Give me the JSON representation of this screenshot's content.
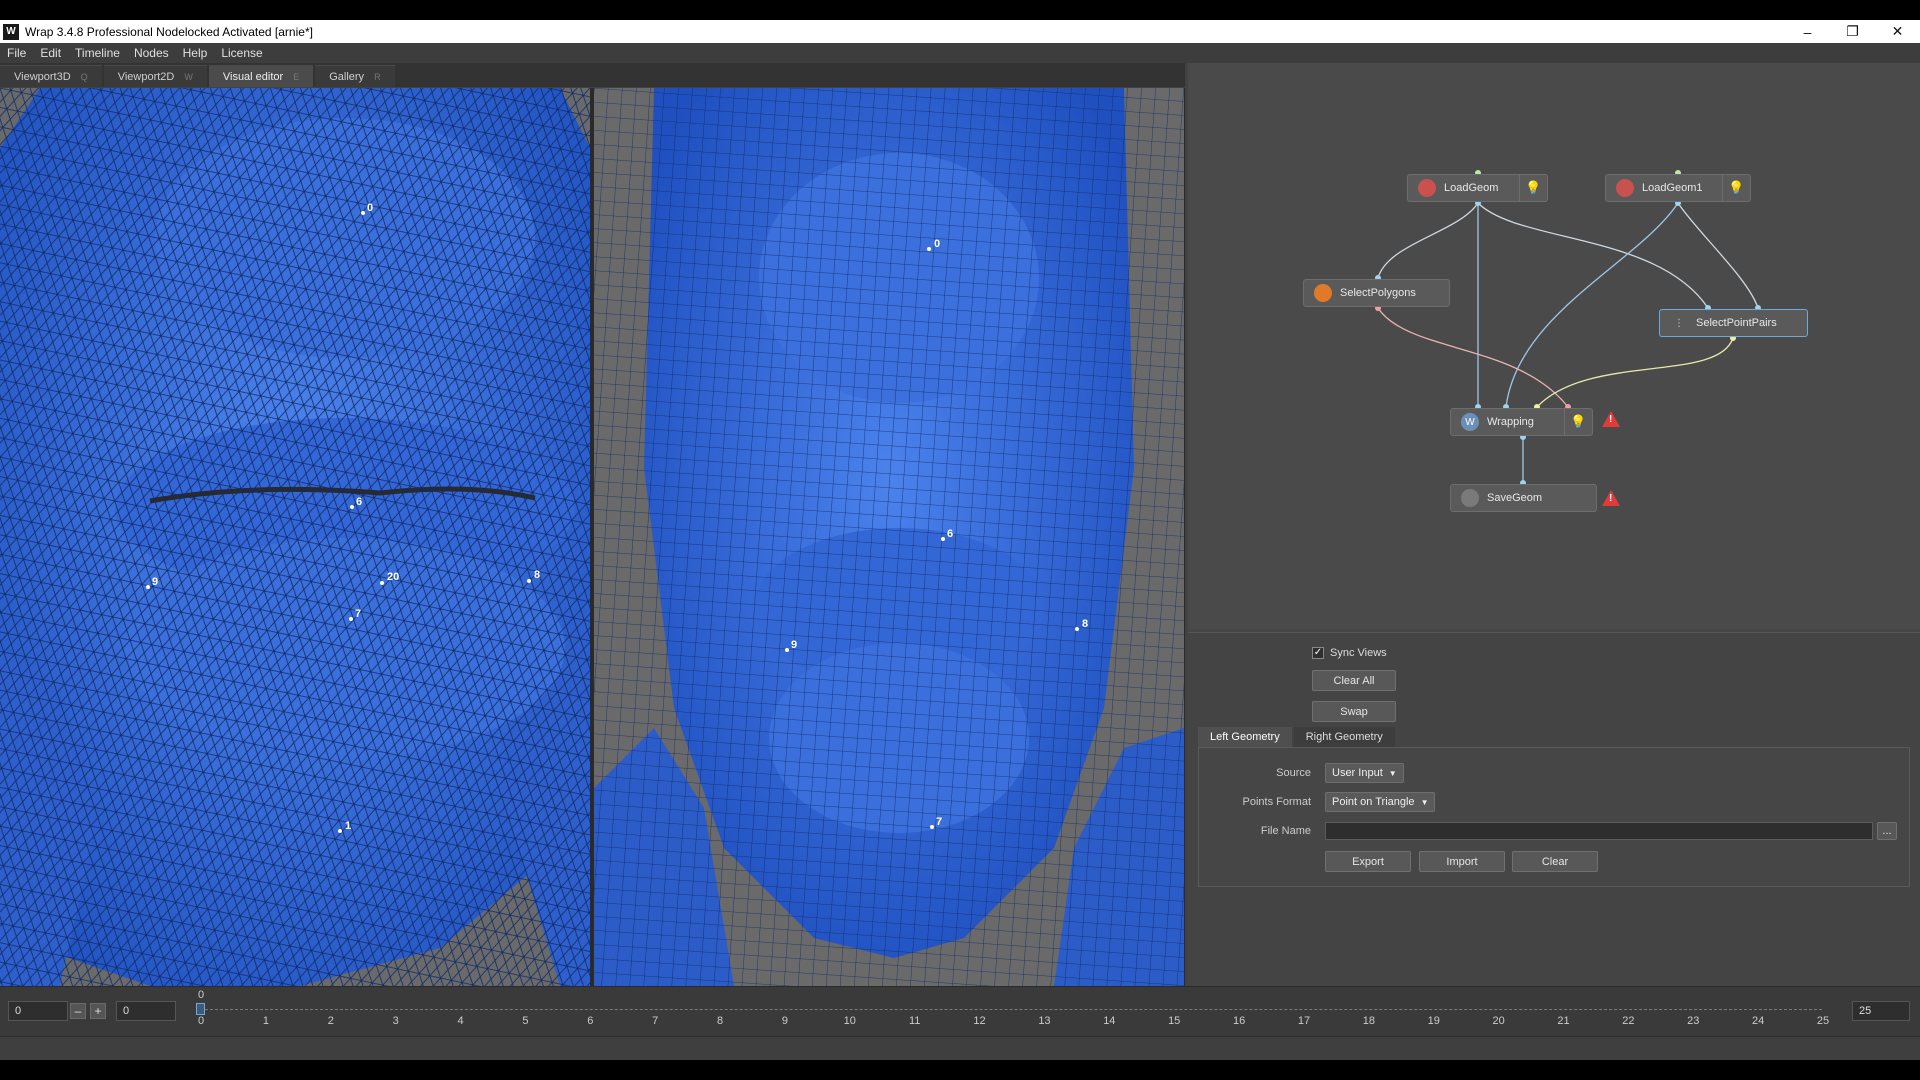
{
  "window": {
    "title": "Wrap 3.4.8 Professional Nodelocked Activated [arnie*]",
    "app_icon": "W",
    "minimize": "–",
    "maximize": "❐",
    "close": "✕"
  },
  "menu": [
    "File",
    "Edit",
    "Timeline",
    "Nodes",
    "Help",
    "License"
  ],
  "tabs": [
    {
      "label": "Viewport3D",
      "shortcut": "Q"
    },
    {
      "label": "Viewport2D",
      "shortcut": "W"
    },
    {
      "label": "Visual editor",
      "shortcut": "E",
      "active": true
    },
    {
      "label": "Gallery",
      "shortcut": "R"
    }
  ],
  "viewport_left": {
    "points": [
      "0",
      "6",
      "9",
      "20",
      "8",
      "7",
      "1"
    ]
  },
  "viewport_right": {
    "points": [
      "0",
      "6",
      "9",
      "8",
      "7"
    ]
  },
  "nodes": {
    "loadgeom": "LoadGeom",
    "loadgeom1": "LoadGeom1",
    "selectpolygons": "SelectPolygons",
    "selectpointpairs": "SelectPointPairs",
    "wrapping": "Wrapping",
    "savegeom": "SaveGeom",
    "warning_glyph": "!",
    "visibility_glyph": "💡"
  },
  "props": {
    "sync_views": "Sync Views",
    "sync_checked": "✓",
    "clear_all": "Clear All",
    "swap": "Swap",
    "subtabs": [
      "Left Geometry",
      "Right Geometry"
    ],
    "source_label": "Source",
    "source_value": "User Input",
    "points_format_label": "Points Format",
    "points_format_value": "Point on Triangle",
    "file_name_label": "File Name",
    "file_name_value": "",
    "browse": "...",
    "export": "Export",
    "import": "Import",
    "clear": "Clear"
  },
  "timeline": {
    "start": "0",
    "current": "0",
    "minus": "–",
    "plus": "+",
    "end": "25",
    "marker_label": "0",
    "ticks": [
      "0",
      "1",
      "2",
      "3",
      "4",
      "5",
      "6",
      "7",
      "8",
      "9",
      "10",
      "11",
      "12",
      "13",
      "14",
      "15",
      "16",
      "17",
      "18",
      "19",
      "20",
      "21",
      "22",
      "23",
      "24",
      "25"
    ]
  }
}
